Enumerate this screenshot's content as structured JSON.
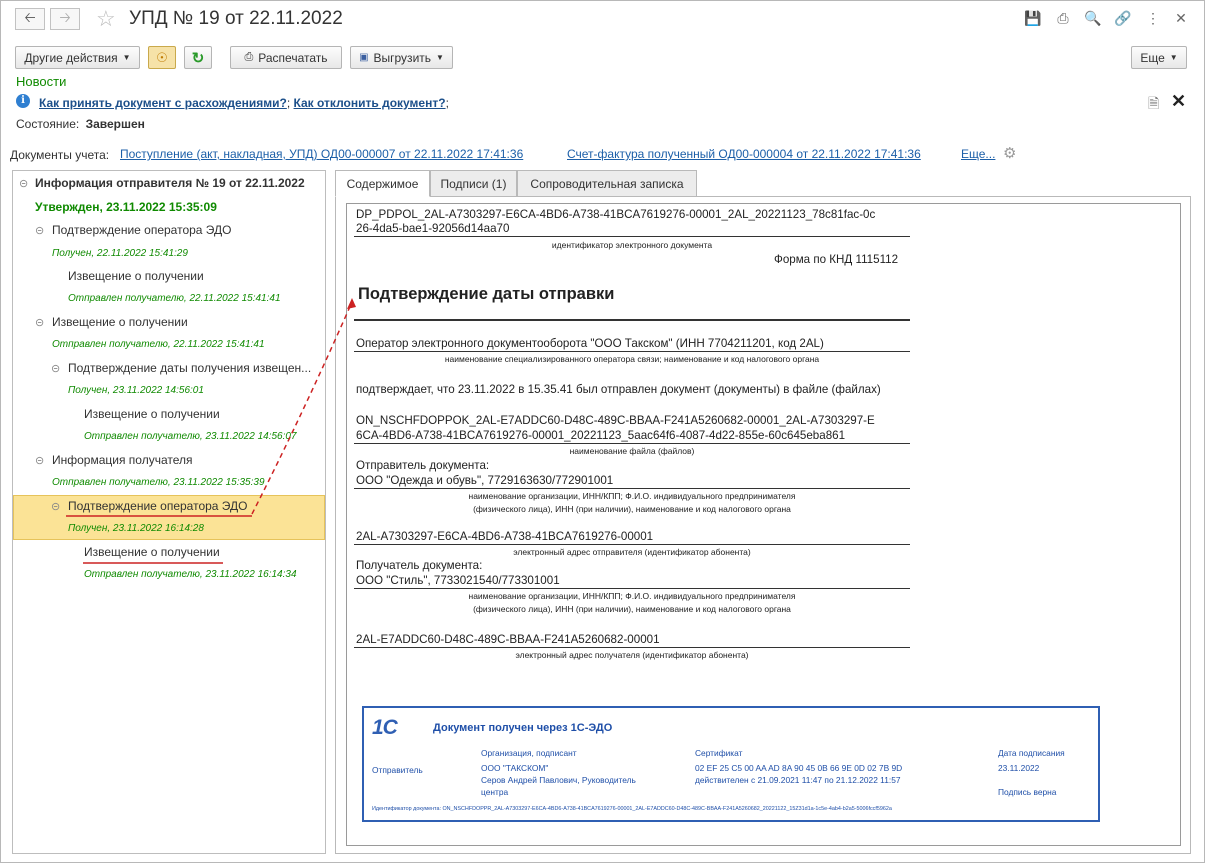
{
  "window": {
    "title": "УПД № 19 от 22.11.2022"
  },
  "toolbar": {
    "other_actions": "Другие действия",
    "print": "Распечатать",
    "export": "Выгрузить",
    "more": "Еще"
  },
  "news": {
    "label": "Новости",
    "link1": "Как принять документ с расхождениями?",
    "sep1": ";",
    "link2": "Как отклонить документ?",
    "sep2": ";"
  },
  "state": {
    "label": "Состояние:",
    "value": "Завершен"
  },
  "accounting": {
    "label": "Документы учета:",
    "link1": "Поступление (акт, накладная, УПД) ОД00-000007 от 22.11.2022 17:41:36",
    "link2": "Счет-фактура полученный ОД00-000004 от 22.11.2022 17:41:36",
    "more": "Еще..."
  },
  "tree": [
    {
      "title": "Информация отправителя № 19 от 22.11.2022",
      "status": "Утвержден, 23.11.2022 15:35:09"
    },
    {
      "title": "Подтверждение оператора ЭДО",
      "status": "Получен, 22.11.2022 15:41:29"
    },
    {
      "title": "Извещение о получении",
      "status": "Отправлен получателю, 22.11.2022 15:41:41"
    },
    {
      "title": "Извещение о получении",
      "status": "Отправлен получателю, 22.11.2022 15:41:41"
    },
    {
      "title": "Подтверждение даты получения извещен...",
      "status": "Получен, 23.11.2022 14:56:01"
    },
    {
      "title": "Извещение о получении",
      "status": "Отправлен получателю, 23.11.2022 14:56:07"
    },
    {
      "title": "Информация получателя",
      "status": "Отправлен получателю, 23.11.2022 15:35:39"
    },
    {
      "title": "Подтверждение оператора ЭДО",
      "status": "Получен, 23.11.2022 16:14:28"
    },
    {
      "title": "Извещение о получении",
      "status": "Отправлен получателю, 23.11.2022 16:14:34"
    }
  ],
  "tabs": [
    "Содержимое",
    "Подписи (1)",
    "Сопроводительная записка"
  ],
  "document": {
    "file_id_1": "DP_PDPOL_2AL-A7303297-E6CA-4BD6-A738-41BCA7619276-00001_2AL_20221123_78c81fac-0c",
    "file_id_2": "26-4da5-bae1-92056d14aa70",
    "file_id_caption": "идентификатор электронного документа",
    "form": "Форма по КНД 1115112",
    "heading": "Подтверждение даты отправки",
    "operator": "Оператор электронного документооборота \"ООО Такском\" (ИНН 7704211201, код 2AL)",
    "operator_caption": "наименование специализированного оператора связи; наименование и код налогового органа",
    "confirm": "подтверждает, что 23.11.2022 в 15.35.41 был отправлен документ (документы) в файле (файлах)",
    "file_name_1": "ON_NSCHFDOPPOK_2AL-E7ADDC60-D48C-489C-BBAA-F241A5260682-00001_2AL-A7303297-E",
    "file_name_2": "6CA-4BD6-A738-41BCA7619276-00001_20221123_5aac64f6-4087-4d22-855e-60c645eba861",
    "file_name_caption": "наименование файла (файлов)",
    "sender_label": "Отправитель документа:",
    "sender": "ООО \"Одежда и обувь\", 7729163630/772901001",
    "org_caption_1": "наименование организации, ИНН/КПП; Ф.И.О. индивидуального предпринимателя",
    "org_caption_2": "(физического лица), ИНН (при наличии), наименование и код налогового органа",
    "sender_address": "2AL-A7303297-E6CA-4BD6-A738-41BCA7619276-00001",
    "sender_address_caption": "электронный адрес отправителя (идентификатор абонента)",
    "receiver_label": "Получатель документа:",
    "receiver": "ООО \"Стиль\", 7733021540/773301001",
    "receiver_address": "2AL-E7ADDC60-D48C-489C-BBAA-F241A5260682-00001",
    "receiver_address_caption": "электронный адрес получателя (идентификатор абонента)"
  },
  "stamp": {
    "logo": "1С",
    "title": "Документ получен через 1С-ЭДО",
    "col_org": "Организация, подписант",
    "col_cert": "Сертификат",
    "col_date": "Дата подписания",
    "row_label": "Отправитель",
    "org": "ООО \"ТАКСКОМ\"",
    "signer": "Серов Андрей Павлович, Руководитель",
    "signer2": "центра",
    "cert": "02 EF 25 C5 00 AA AD 8A 90 45 0B 66 9E 0D 02 7B 9D",
    "cert_valid": "действителен с 21.09.2021 11:47 по 21.12.2022 11:57",
    "date": "23.11.2022",
    "sign_ok": "Подпись верна",
    "doc_id": "Идентификатор документа: ON_NSCHFDOPPR_2AL-A7303297-E6CA-4BD6-A738-41BCA7619276-00001_2AL-E7ADDC60-D48C-489C-BBAA-F241A5260682_20221122_15Z31d1a-1c5e-4ab4-b2a5-5006fccf5962a"
  },
  "colors": {
    "accent_green": "#0f8a00",
    "link_blue": "#1c5fa8",
    "selection": "#fbe396",
    "annotation_red": "#cc2222",
    "stamp_blue": "#2f5fb3"
  }
}
